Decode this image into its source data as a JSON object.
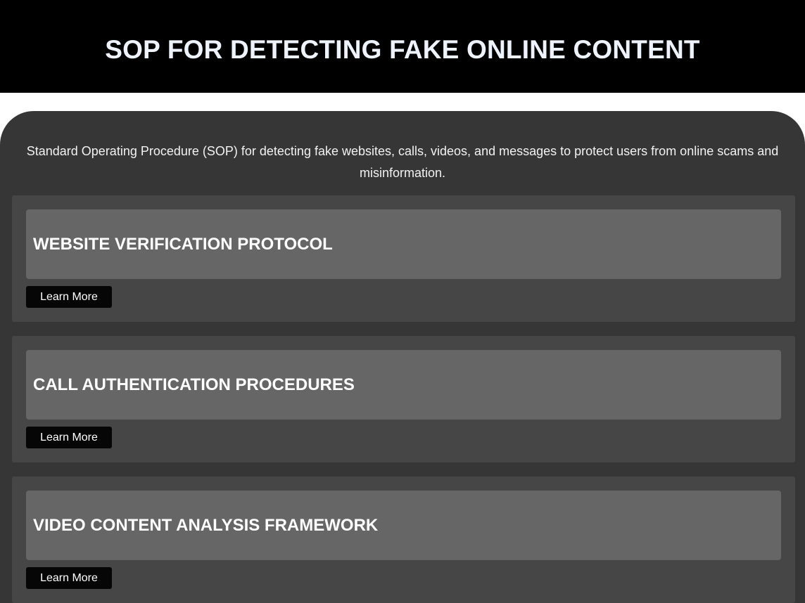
{
  "header": {
    "title": "SOP FOR DETECTING FAKE ONLINE CONTENT"
  },
  "intro": "Standard Operating Procedure (SOP) for detecting fake websites, calls, videos, and messages to protect users from online scams and misinformation.",
  "sections": [
    {
      "heading": "WEBSITE VERIFICATION PROTOCOL",
      "button_label": "Learn More"
    },
    {
      "heading": "CALL AUTHENTICATION PROCEDURES",
      "button_label": "Learn More"
    },
    {
      "heading": "VIDEO CONTENT ANALYSIS FRAMEWORK",
      "button_label": "Learn More"
    }
  ],
  "colors": {
    "header_bg": "#000000",
    "panel_bg": "#363636",
    "card_bg": "#464646",
    "heading_box_bg": "#666666",
    "button_bg": "#060606"
  }
}
